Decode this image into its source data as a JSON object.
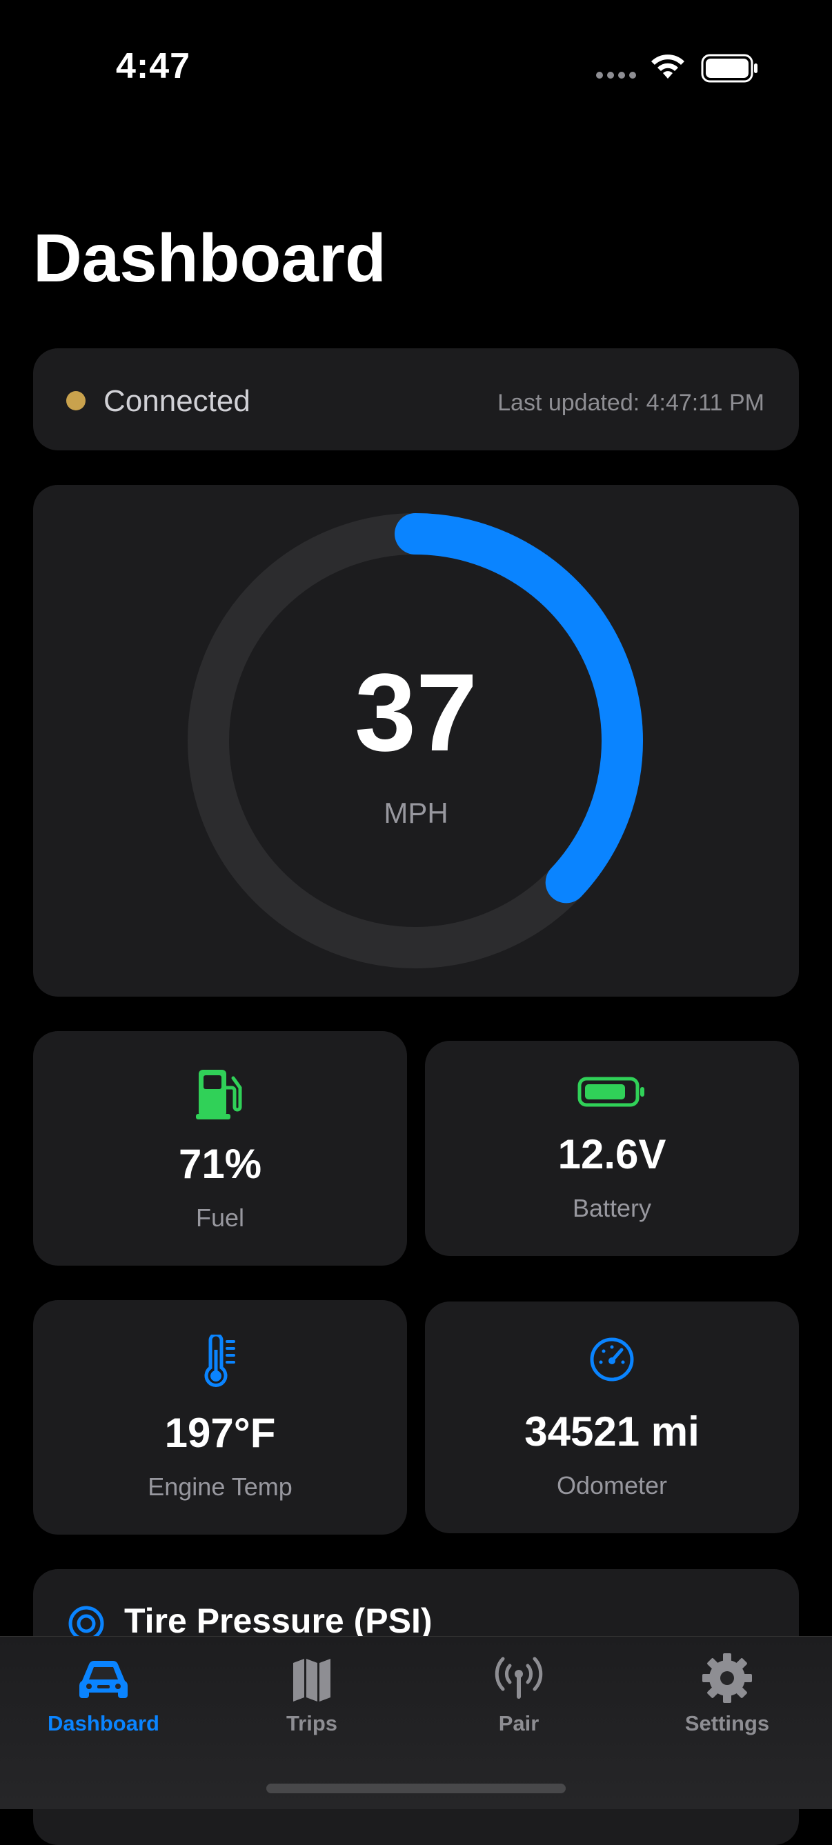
{
  "status_bar": {
    "time": "4:47"
  },
  "colors": {
    "accent": "#0a84ff",
    "connected_dot": "#c9a24d",
    "fuel_green": "#30d158",
    "battery_green": "#30d158",
    "card": "#1c1c1e"
  },
  "page": {
    "title": "Dashboard"
  },
  "connection": {
    "status": "Connected",
    "last_updated": "Last updated: 4:47:11 PM"
  },
  "speed": {
    "value": "37",
    "unit": "MPH",
    "gauge_fraction": 0.37
  },
  "stats": {
    "fuel": {
      "value": "71%",
      "label": "Fuel",
      "icon": "fuel-pump-icon"
    },
    "battery": {
      "value": "12.6V",
      "label": "Battery",
      "icon": "battery-icon"
    },
    "engine_temp": {
      "value": "197°F",
      "label": "Engine Temp",
      "icon": "thermometer-icon"
    },
    "odometer": {
      "value": "34521 mi",
      "label": "Odometer",
      "icon": "speedometer-icon"
    }
  },
  "tire_pressure": {
    "title": "Tire Pressure (PSI)",
    "icon": "tire-icon"
  },
  "tabs": [
    {
      "label": "Dashboard",
      "icon": "car-icon",
      "active": true
    },
    {
      "label": "Trips",
      "icon": "map-icon",
      "active": false
    },
    {
      "label": "Pair",
      "icon": "antenna-icon",
      "active": false
    },
    {
      "label": "Settings",
      "icon": "gear-icon",
      "active": false
    }
  ]
}
